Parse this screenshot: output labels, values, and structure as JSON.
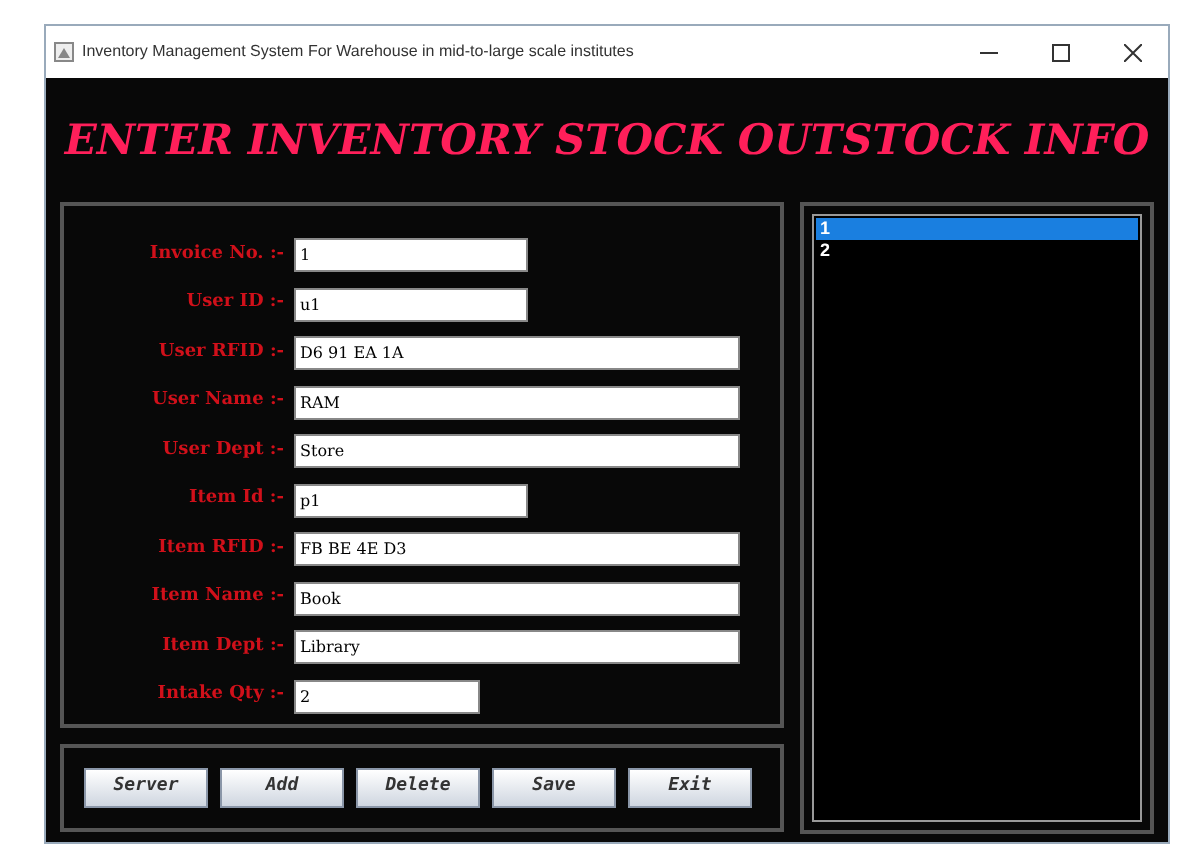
{
  "window": {
    "title": "Inventory Management System For Warehouse in mid-to-large scale institutes"
  },
  "heading": "ENTER INVENTORY STOCK OUTSTOCK INFO",
  "fields": [
    {
      "label": "Invoice No. :-",
      "value": "1",
      "kind": "short"
    },
    {
      "label": "User ID :-",
      "value": "u1",
      "kind": "short"
    },
    {
      "label": "User RFID :-",
      "value": "D6 91 EA 1A",
      "kind": "long"
    },
    {
      "label": "User Name :-",
      "value": "RAM",
      "kind": "long"
    },
    {
      "label": "User Dept :-",
      "value": "Store",
      "kind": "long"
    },
    {
      "label": "Item Id :-",
      "value": "p1",
      "kind": "short"
    },
    {
      "label": "Item RFID :-",
      "value": "FB BE 4E D3",
      "kind": "long"
    },
    {
      "label": "Item Name :-",
      "value": "Book",
      "kind": "long"
    },
    {
      "label": "Item Dept :-",
      "value": "Library",
      "kind": "long"
    },
    {
      "label": "Intake Qty :-",
      "value": "2",
      "kind": "medium"
    }
  ],
  "buttons": [
    "Server",
    "Add",
    "Delete",
    "Save",
    "Exit"
  ],
  "list": [
    {
      "text": "1",
      "selected": true
    },
    {
      "text": "2",
      "selected": false
    }
  ]
}
